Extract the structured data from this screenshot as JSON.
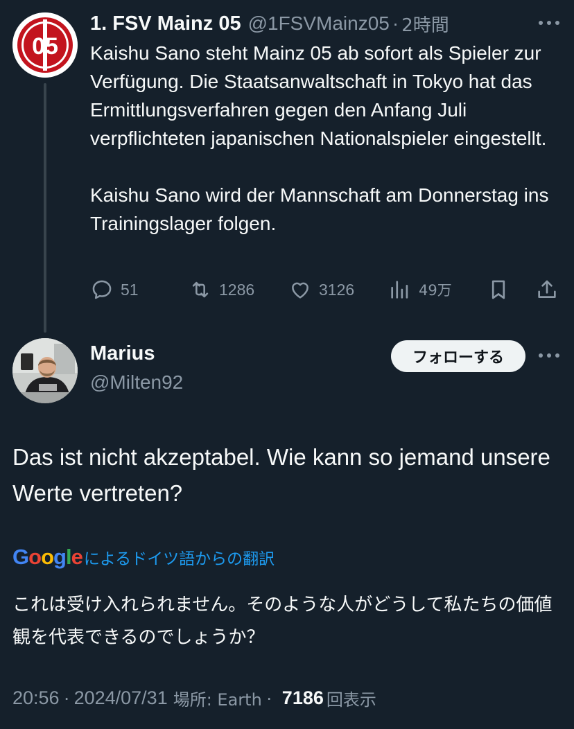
{
  "parent": {
    "name": "1. FSV Mainz 05",
    "handle": "@1FSVMainz05",
    "sep": "·",
    "time": "2時間",
    "paragraphs": [
      "Kaishu Sano steht Mainz 05 ab sofort als Spieler zur Verfügung. Die Staatsanwaltschaft in Tokyo hat das Ermittlungsverfahren gegen den Anfang Juli verpflichteten japanischen Nationalspieler eingestellt.",
      "Kaishu Sano wird der Mannschaft am Donnerstag ins Trainingslager folgen."
    ],
    "actions": {
      "replies": "51",
      "reposts": "1286",
      "likes": "3126",
      "views": "49万"
    },
    "logo_text": "05"
  },
  "reply": {
    "name": "Marius",
    "handle": "@Milten92",
    "follow_label": "フォローする",
    "text": "Das ist nicht akzeptabel. Wie kann so jemand unsere Werte vertreten?",
    "translate_link": "によるドイツ語からの翻訳",
    "translation": "これは受け入れられません。そのような人がどうして私たちの価値観を代表できるのでしょうか？",
    "time": "20:56",
    "sep1": "·",
    "date": "2024/07/31",
    "location_label": "場所: Earth",
    "sep2": "·",
    "views_count": "7186",
    "views_label": "回表示"
  },
  "google_logo": {
    "letters": [
      "G",
      "o",
      "o",
      "g",
      "l",
      "e"
    ],
    "colors": [
      "#4285f4",
      "#ea4335",
      "#fbbc05",
      "#4285f4",
      "#34a853",
      "#ea4335"
    ]
  },
  "colors": {
    "background": "#15202b",
    "text_primary": "#f7f9f9",
    "text_secondary": "#8b98a5",
    "link": "#1d9bf0",
    "mainz_red": "#c3141e",
    "thread_line": "#38444d"
  }
}
